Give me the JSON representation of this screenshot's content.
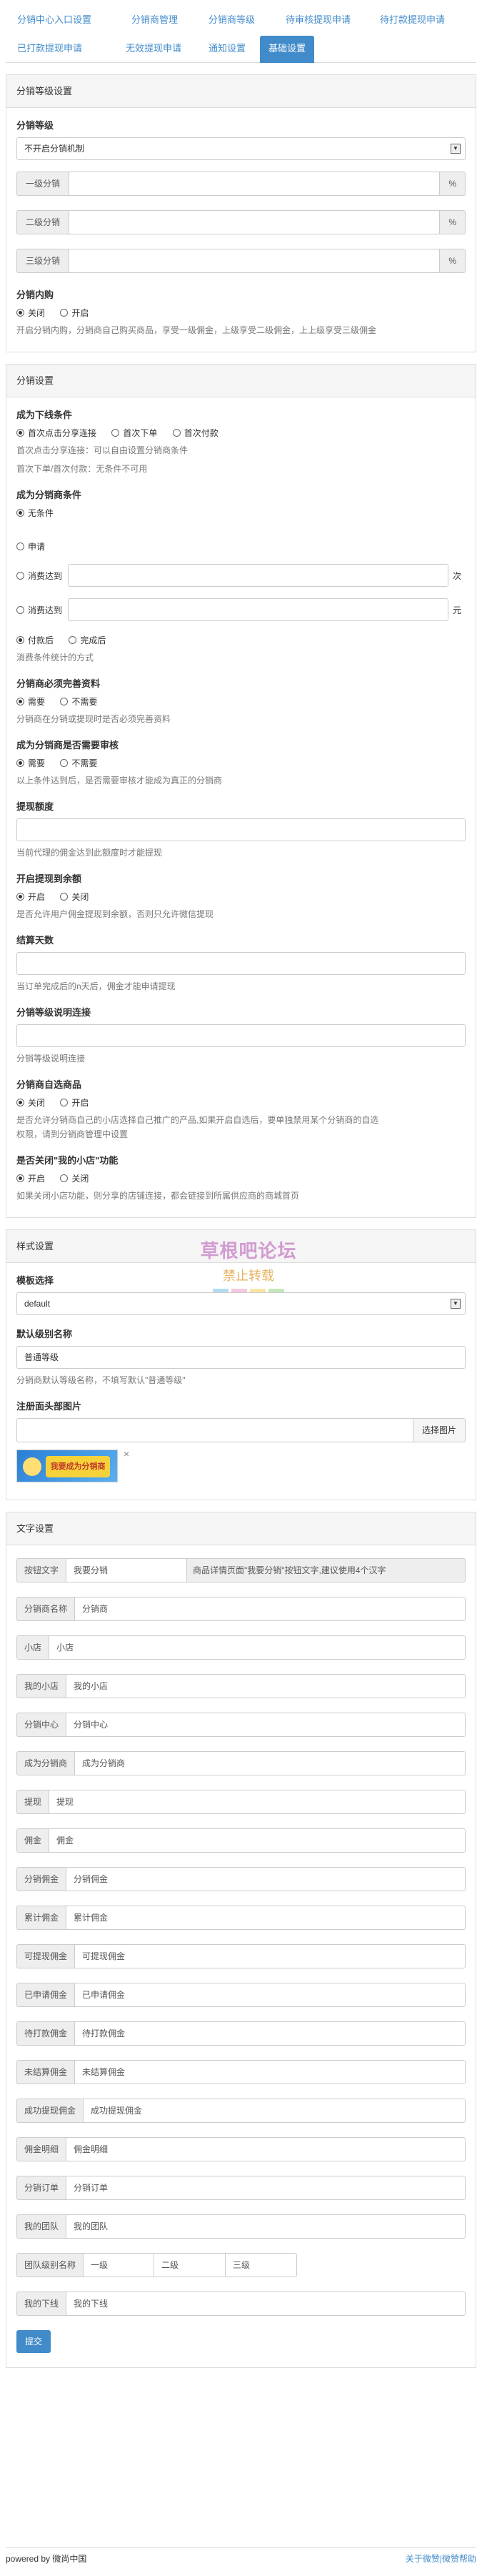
{
  "tabs": [
    {
      "label": "分销中心入口设置"
    },
    {
      "label": "分销商管理"
    },
    {
      "label": "分销商等级"
    },
    {
      "label": "待审核提现申请"
    },
    {
      "label": "待打款提现申请"
    },
    {
      "label": "已打款提现申请"
    },
    {
      "label": "无效提现申请"
    },
    {
      "label": "通知设置"
    },
    {
      "label": "基础设置"
    }
  ],
  "level_section": {
    "heading": "分销等级设置",
    "level_label": "分销等级",
    "level_value": "不开启分销机制",
    "rows": [
      {
        "label": "一级分销",
        "unit": "%"
      },
      {
        "label": "二级分销",
        "unit": "%"
      },
      {
        "label": "三级分销",
        "unit": "%"
      }
    ],
    "internal_label": "分销内购",
    "internal_off": "关闭",
    "internal_on": "开启",
    "internal_help": "开启分销内购，分销商自己购买商品，享受一级佣金，上级享受二级佣金，上上级享受三级佣金"
  },
  "dist_section": {
    "heading": "分销设置",
    "downline_label": "成为下线条件",
    "downline_opts": [
      "首次点击分享连接",
      "首次下单",
      "首次付款"
    ],
    "downline_help1": "首次点击分享连接：可以自由设置分销商条件",
    "downline_help2": "首次下单/首次付款：无条件不可用",
    "become_label": "成为分销商条件",
    "cond_unconditional": "无条件",
    "cond_apply": "申请",
    "cond_spend": "消费达到",
    "cond_spend_unit": "次",
    "cond_amount": "消费达到",
    "cond_amount_unit": "元",
    "stat_paid": "付款后",
    "stat_done": "完成后",
    "stat_help": "消费条件统计的方式",
    "info_label": "分销商必须完善资料",
    "info_yes": "需要",
    "info_no": "不需要",
    "info_help": "分销商在分销或提现时是否必须完善资料",
    "audit_label": "成为分销商是否需要审核",
    "audit_yes": "需要",
    "audit_no": "不需要",
    "audit_help": "以上条件达到后，是否需要审核才能成为真正的分销商",
    "withdraw_label": "提现额度",
    "withdraw_help": "当前代理的佣金达到此额度时才能提现",
    "balance_label": "开启提现到余额",
    "balance_on": "开启",
    "balance_off": "关闭",
    "balance_help": "是否允许用户佣金提现到余额，否则只允许微信提现",
    "settle_label": "结算天数",
    "settle_help": "当订单完成后的n天后，佣金才能申请提现",
    "levelurl_label": "分销等级说明连接",
    "levelurl_help": "分销等级说明连接",
    "selfpick_label": "分销商自选商品",
    "selfpick_off": "关闭",
    "selfpick_on": "开启",
    "selfpick_help1": "是否允许分销商自己的小店选择自己推广的产品,如果开启自选后，要单独禁用某个分销商的自选",
    "selfpick_help2": "权限，请到分销商管理中设置",
    "shop_label": "是否关闭\"我的小店\"功能",
    "shop_on": "开启",
    "shop_off": "关闭",
    "shop_help": "如果关闭小店功能，则分享的店铺连接，都会链接到所属供应商的商城首页"
  },
  "watermark": {
    "line1": "草根吧论坛",
    "line2": "禁止转载"
  },
  "style_section": {
    "heading": "样式设置",
    "template_label": "模板选择",
    "template_value": "default",
    "default_level_label": "默认级别名称",
    "default_level_value": "普通等级",
    "default_level_help": "分销商默认等级名称，不填写默认\"普通等级\"",
    "reg_img_label": "注册面头部图片",
    "choose_image": "选择图片",
    "banner_text": "我要成为分销商",
    "close_mark": "×"
  },
  "text_section": {
    "heading": "文字设置",
    "btn_label": "按钮文字",
    "btn_value": "我要分销",
    "btn_help": "商品详情页面\"我要分销\"按钮文字,建议使用4个汉字",
    "rows": [
      {
        "label": "分销商名称",
        "value": "分销商"
      },
      {
        "label": "小店",
        "value": "小店"
      },
      {
        "label": "我的小店",
        "value": "我的小店"
      },
      {
        "label": "分销中心",
        "value": "分销中心"
      },
      {
        "label": "成为分销商",
        "value": "成为分销商"
      },
      {
        "label": "提现",
        "value": "提现"
      },
      {
        "label": "佣金",
        "value": "佣金"
      },
      {
        "label": "分销佣金",
        "value": "分销佣金"
      },
      {
        "label": "累计佣金",
        "value": "累计佣金"
      },
      {
        "label": "可提现佣金",
        "value": "可提现佣金"
      },
      {
        "label": "已申请佣金",
        "value": "已申请佣金"
      },
      {
        "label": "待打款佣金",
        "value": "待打款佣金"
      },
      {
        "label": "未结算佣金",
        "value": "未结算佣金"
      },
      {
        "label": "成功提现佣金",
        "value": "成功提现佣金"
      },
      {
        "label": "佣金明细",
        "value": "佣金明细"
      },
      {
        "label": "分销订单",
        "value": "分销订单"
      },
      {
        "label": "我的团队",
        "value": "我的团队"
      }
    ],
    "tier_label": "团队级别名称",
    "tier_values": [
      "一级",
      "二级",
      "三级"
    ],
    "downline_label": "我的下线",
    "downline_value": "我的下线",
    "submit": "提交"
  },
  "footer": {
    "left": "powered by 微尚中国",
    "right": "关于微赞|微赞帮助"
  }
}
